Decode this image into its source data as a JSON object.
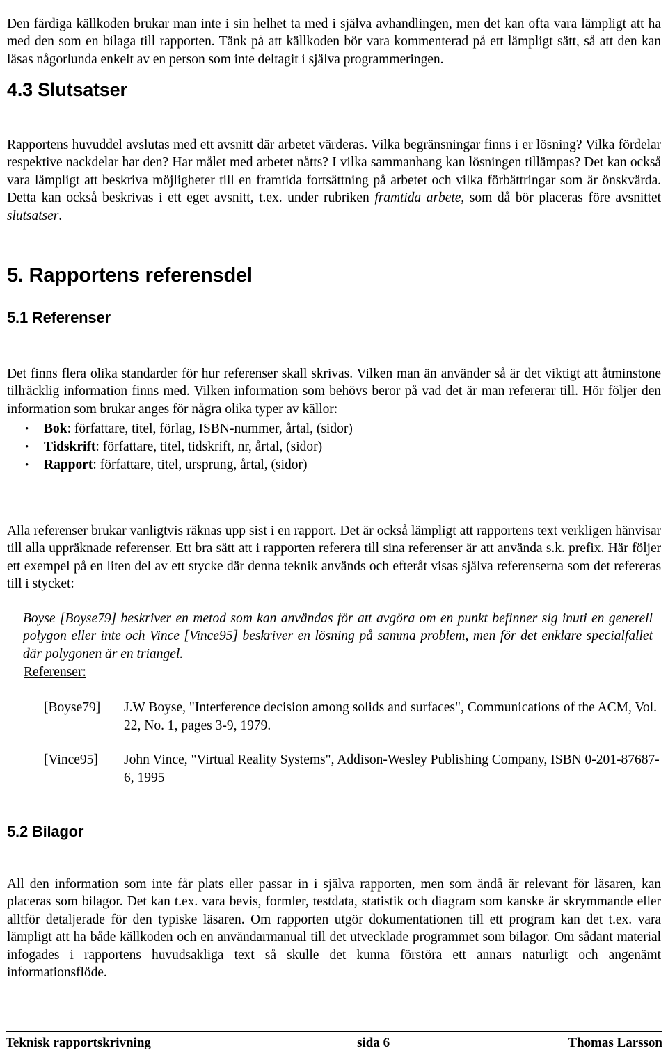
{
  "document": {
    "title": "Teknisk rapportskrivning",
    "page_label": "sida 6",
    "author": "Thomas Larsson"
  },
  "intro_paragraph": {
    "text": "Den färdiga källkoden brukar man inte i sin helhet ta med i själva avhandlingen, men det kan ofta vara lämpligt att ha med den som en bilaga till rapporten. Tänk på att källkoden bör vara kommenterad på ett lämpligt sätt, så att den kan läsas någorlunda enkelt av en person som inte deltagit i själva programmeringen."
  },
  "section_4_3": {
    "heading": "4.3 Slutsatser",
    "paragraph_part1": "Rapportens huvuddel avslutas med ett avsnitt där arbetet värderas. Vilka begränsningar finns i er lösning? Vilka fördelar respektive nackdelar har den? Har målet med arbetet nåtts? I vilka sammanhang kan lösningen tillämpas? Det kan också vara lämpligt att beskriva möjligheter till en framtida fortsättning på arbetet och vilka förbättringar som är önskvärda. Detta kan också beskrivas i ett eget avsnitt, t.ex. under rubriken ",
    "italic_1": "framtida arbete",
    "paragraph_part2": ", som då bör placeras före avsnittet ",
    "italic_2": "slutsatser",
    "paragraph_part3": "."
  },
  "section_5": {
    "heading": "5. Rapportens referensdel"
  },
  "section_5_1": {
    "heading": "5.1 Referenser",
    "paragraph_intro": "Det finns flera olika standarder för hur referenser skall skrivas. Vilken man än använder så är det viktigt att åtminstone tillräcklig information finns med. Vilken information som behövs beror på vad det är man refererar till. Hör följer den information som brukar anges för några olika typer av källor:",
    "bullet_marker": "•",
    "bullets": [
      {
        "label": "Bok",
        "rest": ": författare, titel, förlag, ISBN-nummer, årtal, (sidor)"
      },
      {
        "label": "Tidskrift",
        "rest": ": författare, titel, tidskrift, nr, årtal, (sidor)"
      },
      {
        "label": "Rapport",
        "rest": ": författare, titel, ursprung, årtal, (sidor)"
      }
    ],
    "paragraph_after_list": "Alla referenser brukar vanligtvis räknas upp sist i en rapport. Det är också lämpligt att rapportens text verkligen hänvisar till alla uppräknade referenser. Ett bra sätt att i rapporten referera till sina referenser är att använda s.k. prefix. Här följer ett exempel på en liten del av ett stycke där denna teknik används och efteråt visas själva referenserna som det refereras till i stycket:",
    "example_text": "Boyse [Boyse79] beskriver en metod som kan användas för att avgöra om en punkt befinner sig inuti en generell polygon eller inte och Vince [Vince95] beskriver en lösning på samma problem, men för det enklare specialfallet där polygonen är en triangel.",
    "references_label": "Referenser:",
    "references": [
      {
        "key": "[Boyse79]",
        "text": "J.W Boyse, \"Interference decision among solids and surfaces\", Communications of the ACM, Vol. 22, No. 1, pages 3-9, 1979."
      },
      {
        "key": "[Vince95]",
        "text": "John Vince, \"Virtual Reality Systems\", Addison-Wesley Publishing Company, ISBN 0-201-87687-6, 1995"
      }
    ]
  },
  "section_5_2": {
    "heading": "5.2 Bilagor",
    "paragraph": "All den information som inte får plats eller passar in i själva rapporten, men som ändå är relevant för läsaren, kan placeras som bilagor. Det kan t.ex. vara bevis, formler, testdata, statistik och diagram som kanske är skrymmande eller alltför detaljerade för den typiske läsaren. Om rapporten utgör dokumentationen till ett program kan det t.ex. vara lämpligt att ha både källkoden och en användarmanual till det utvecklade programmet som bilagor. Om sådant material infogades i rapportens huvudsakliga text så skulle det kunna förstöra ett annars naturligt och angenämt informationsflöde."
  }
}
